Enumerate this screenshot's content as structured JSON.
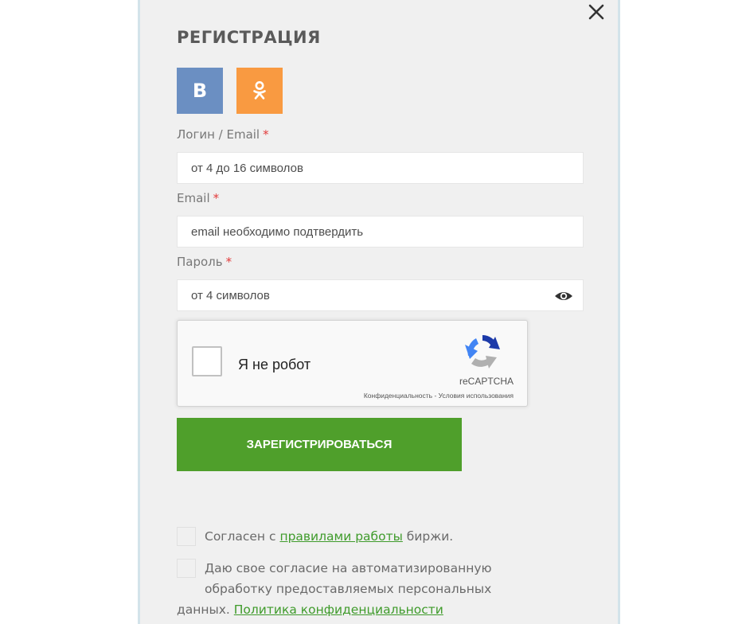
{
  "modal": {
    "title": "РЕГИСТРАЦИЯ",
    "close_icon": "close-icon"
  },
  "social": {
    "vk": {
      "label": "B",
      "color": "#6b8fc2",
      "icon": "vk-icon"
    },
    "ok": {
      "color": "#f99a41",
      "icon": "odnoklassniki-icon"
    }
  },
  "form": {
    "login": {
      "label": "Логин / Email",
      "required_mark": "*",
      "placeholder": "от 4 до 16 символов"
    },
    "email": {
      "label": "Email",
      "required_mark": "*",
      "placeholder": "email необходимо подтвердить"
    },
    "password": {
      "label": "Пароль",
      "required_mark": "*",
      "placeholder": "от 4 символов",
      "toggle_icon": "eye-icon"
    }
  },
  "recaptcha": {
    "label": "Я не робот",
    "brand": "reCAPTCHA",
    "privacy_link": "Конфиденциальность",
    "separator": " - ",
    "terms_link": "Условия использования"
  },
  "submit": {
    "label": "ЗАРЕГИСТРИРОВАТЬСЯ",
    "color": "#4f9f2b"
  },
  "agreements": {
    "rules": {
      "prefix": "Согласен с ",
      "link": "правилами работы",
      "suffix": " биржи."
    },
    "privacy": {
      "line1": "Даю свое согласие на автоматизированную",
      "line2": "обработку предоставляемых персональных",
      "line3_prefix": "данных. ",
      "link": "Политика конфиденциальности"
    }
  },
  "colors": {
    "accent_green": "#4f9f2b",
    "link_green": "#3f9b2b",
    "required_red": "#e23b3b"
  }
}
